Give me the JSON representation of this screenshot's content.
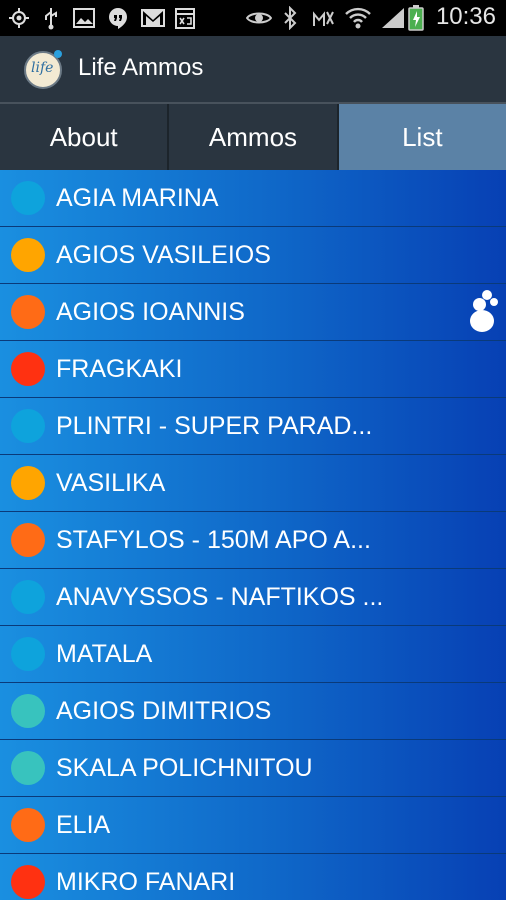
{
  "status_bar": {
    "time": "10:36",
    "icons": [
      "gps-icon",
      "usb-icon",
      "image-icon",
      "hangouts-icon",
      "gmail-icon",
      "calendar-icon",
      "eye-icon",
      "bluetooth-icon",
      "mute-icon",
      "wifi-icon",
      "signal-icon",
      "battery-icon"
    ]
  },
  "app": {
    "title": "Life Ammos",
    "logo_text": "life"
  },
  "tabs": [
    {
      "label": "About"
    },
    {
      "label": "Ammos"
    },
    {
      "label": "List"
    }
  ],
  "selected_tab": "List",
  "colors": {
    "blue": "#0ea3dc",
    "orange": "#ffa500",
    "deep_orange": "#ff6b16",
    "red": "#ff3111",
    "teal": "#38c3be"
  },
  "beaches": [
    {
      "name": "AGIA MARINA",
      "color": "#0ea3dc"
    },
    {
      "name": "AGIOS VASILEIOS",
      "color": "#ffa500"
    },
    {
      "name": "AGIOS IOANNIS",
      "color": "#ff6b16"
    },
    {
      "name": "FRAGKAKI",
      "color": "#ff3111"
    },
    {
      "name": "PLINTRI - SUPER PARAD...",
      "color": "#0ea3dc"
    },
    {
      "name": "VASILIKA",
      "color": "#ffa500"
    },
    {
      "name": "STAFYLOS - 150M APO A...",
      "color": "#ff6b16"
    },
    {
      "name": "ANAVYSSOS - NAFTIKOS ...",
      "color": "#0ea3dc"
    },
    {
      "name": "MATALA",
      "color": "#0ea3dc"
    },
    {
      "name": "AGIOS DIMITRIOS",
      "color": "#38c3be"
    },
    {
      "name": "SKALA POLICHNITOU",
      "color": "#38c3be"
    },
    {
      "name": "ELIA",
      "color": "#ff6b16"
    },
    {
      "name": "MIKRO FANARI",
      "color": "#ff3111"
    }
  ]
}
